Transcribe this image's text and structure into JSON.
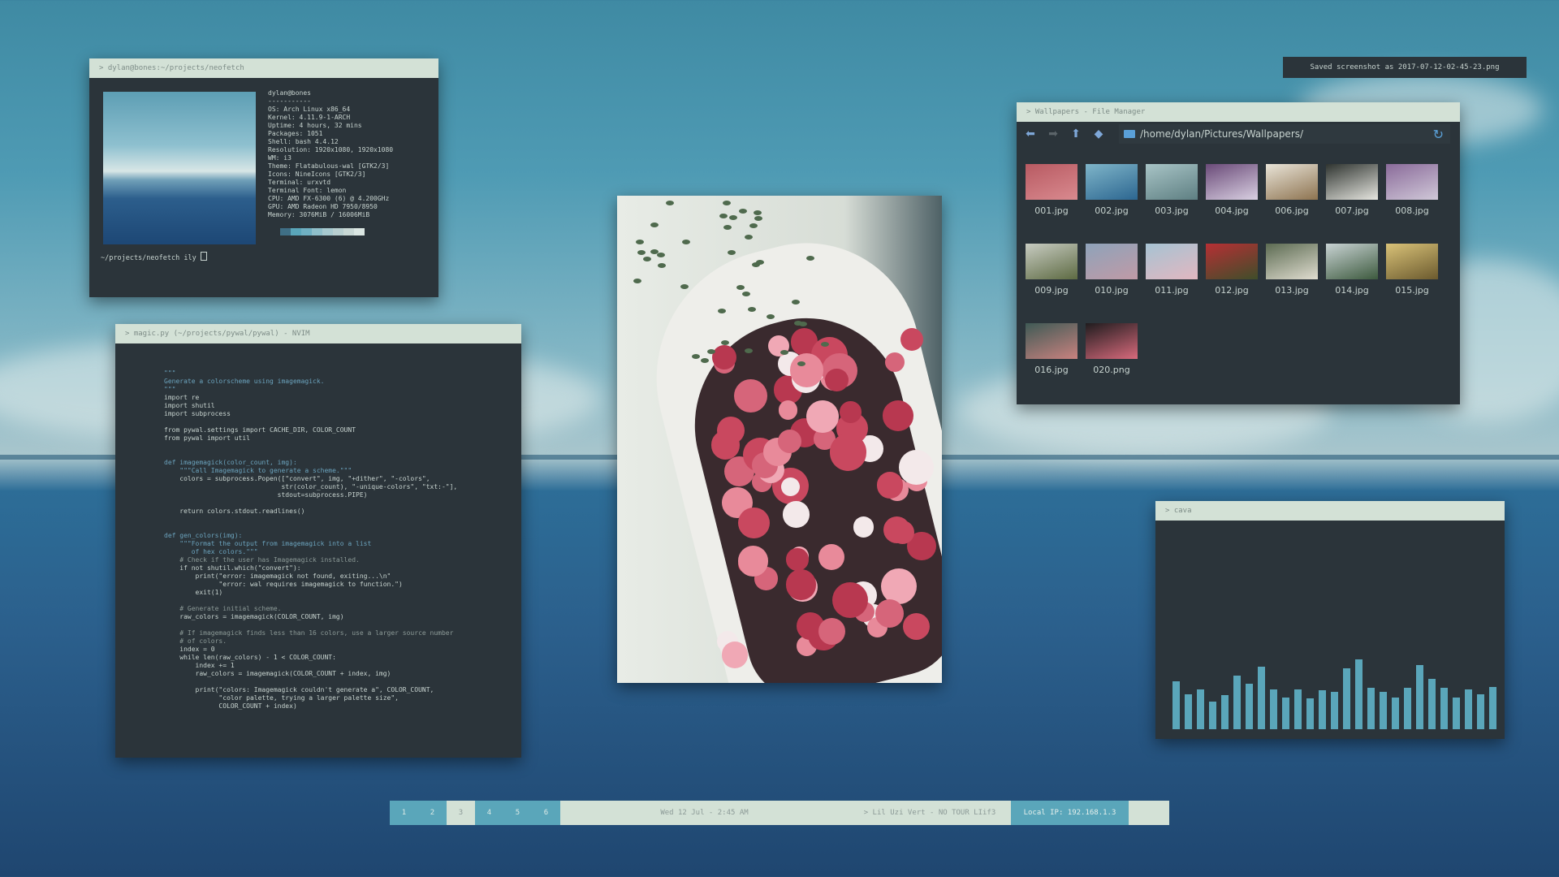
{
  "notification": "Saved screenshot as 2017-07-12-02-45-23.png",
  "neofetch": {
    "title": "> dylan@bones:~/projects/neofetch",
    "info": [
      "dylan@bones",
      "-----------",
      "OS: Arch Linux x86_64",
      "Kernel: 4.11.9-1-ARCH",
      "Uptime: 4 hours, 32 mins",
      "Packages: 1051",
      "Shell: bash 4.4.12",
      "Resolution: 1920x1080, 1920x1080",
      "WM: i3",
      "Theme: Flatabulous-wal [GTK2/3]",
      "Icons: NineIcons [GTK2/3]",
      "Terminal: urxvtd",
      "Terminal Font: lemon",
      "CPU: AMD FX-6300 (6) @ 4.200GHz",
      "GPU: AMD Radeon HD 7950/8950",
      "Memory: 3076MiB / 16006MiB"
    ],
    "palette": [
      "#3f6f86",
      "#5aa6ba",
      "#6fb0c2",
      "#8fbfca",
      "#a7c9cf",
      "#b8cfd0",
      "#c9d8d5",
      "#dbe6e2"
    ],
    "prompt": "~/projects/neofetch ily"
  },
  "nvim": {
    "title": "> magic.py (~/projects/pywal/pywal) - NVIM",
    "lines": [
      [
        "str",
        "\"\"\""
      ],
      [
        "str",
        "Generate a colorscheme using imagemagick."
      ],
      [
        "str",
        "\"\"\""
      ],
      [
        "txt",
        "import re"
      ],
      [
        "txt",
        "import shutil"
      ],
      [
        "txt",
        "import subprocess"
      ],
      [
        "txt",
        ""
      ],
      [
        "txt",
        "from pywal.settings import CACHE_DIR, COLOR_COUNT"
      ],
      [
        "txt",
        "from pywal import util"
      ],
      [
        "txt",
        ""
      ],
      [
        "txt",
        ""
      ],
      [
        "kw",
        "def imagemagick(color_count, img):"
      ],
      [
        "str",
        "    \"\"\"Call Imagemagick to generate a scheme.\"\"\""
      ],
      [
        "txt",
        "    colors = subprocess.Popen([\"convert\", img, \"+dither\", \"-colors\","
      ],
      [
        "txt",
        "                              str(color_count), \"-unique-colors\", \"txt:-\"],"
      ],
      [
        "txt",
        "                             stdout=subprocess.PIPE)"
      ],
      [
        "txt",
        ""
      ],
      [
        "txt",
        "    return colors.stdout.readlines()"
      ],
      [
        "txt",
        ""
      ],
      [
        "txt",
        ""
      ],
      [
        "kw",
        "def gen_colors(img):"
      ],
      [
        "str",
        "    \"\"\"Format the output from imagemagick into a list"
      ],
      [
        "str",
        "       of hex colors.\"\"\""
      ],
      [
        "cm",
        "    # Check if the user has Imagemagick installed."
      ],
      [
        "txt",
        "    if not shutil.which(\"convert\"):"
      ],
      [
        "txt",
        "        print(\"error: imagemagick not found, exiting...\\n\""
      ],
      [
        "txt",
        "              \"error: wal requires imagemagick to function.\")"
      ],
      [
        "txt",
        "        exit(1)"
      ],
      [
        "txt",
        ""
      ],
      [
        "cm",
        "    # Generate initial scheme."
      ],
      [
        "txt",
        "    raw_colors = imagemagick(COLOR_COUNT, img)"
      ],
      [
        "txt",
        ""
      ],
      [
        "cm",
        "    # If imagemagick finds less than 16 colors, use a larger source number"
      ],
      [
        "cm",
        "    # of colors."
      ],
      [
        "txt",
        "    index = 0"
      ],
      [
        "txt",
        "    while len(raw_colors) - 1 < COLOR_COUNT:"
      ],
      [
        "txt",
        "        index += 1"
      ],
      [
        "txt",
        "        raw_colors = imagemagick(COLOR_COUNT + index, img)"
      ],
      [
        "txt",
        ""
      ],
      [
        "txt",
        "        print(\"colors: Imagemagick couldn't generate a\", COLOR_COUNT,"
      ],
      [
        "txt",
        "              \"color palette, trying a larger palette size\","
      ],
      [
        "txt",
        "              COLOR_COUNT + index)"
      ]
    ]
  },
  "file_manager": {
    "title": "> Wallpapers - File Manager",
    "path": "/home/dylan/Pictures/Wallpapers/",
    "files": [
      {
        "name": "001.jpg",
        "colors": [
          "#b85a62",
          "#d98a8f"
        ]
      },
      {
        "name": "002.jpg",
        "colors": [
          "#7fb5c9",
          "#2c6690"
        ]
      },
      {
        "name": "003.jpg",
        "colors": [
          "#a8c4c6",
          "#5e7f82"
        ]
      },
      {
        "name": "004.jpg",
        "colors": [
          "#6a4a78",
          "#d9d0e2"
        ]
      },
      {
        "name": "006.jpg",
        "colors": [
          "#e9e4d8",
          "#8d7350"
        ]
      },
      {
        "name": "007.jpg",
        "colors": [
          "#2f3430",
          "#e6e6e0"
        ]
      },
      {
        "name": "008.jpg",
        "colors": [
          "#8a6b9a",
          "#d0c8d8"
        ]
      },
      {
        "name": "009.jpg",
        "colors": [
          "#c8ccc2",
          "#5d6a42"
        ]
      },
      {
        "name": "010.jpg",
        "colors": [
          "#8ea3ba",
          "#c09aa6"
        ]
      },
      {
        "name": "011.jpg",
        "colors": [
          "#a6c3d3",
          "#e2b7c0"
        ]
      },
      {
        "name": "012.jpg",
        "colors": [
          "#b72f34",
          "#3f4e2a"
        ]
      },
      {
        "name": "013.jpg",
        "colors": [
          "#5c6b52",
          "#e0ddd0"
        ]
      },
      {
        "name": "014.jpg",
        "colors": [
          "#c9d3d4",
          "#3d5a3e"
        ]
      },
      {
        "name": "015.jpg",
        "colors": [
          "#d9c278",
          "#6b5a2e"
        ]
      },
      {
        "name": "016.jpg",
        "colors": [
          "#3f5a55",
          "#c9827f"
        ]
      },
      {
        "name": "020.png",
        "colors": [
          "#1f1c1e",
          "#d86a7c"
        ]
      }
    ]
  },
  "cava": {
    "title": "> cava",
    "bar_levels": [
      0.45,
      0.33,
      0.38,
      0.26,
      0.32,
      0.51,
      0.43,
      0.59,
      0.38,
      0.3,
      0.38,
      0.29,
      0.37,
      0.35,
      0.58,
      0.66,
      0.39,
      0.35,
      0.3,
      0.39,
      0.61,
      0.48,
      0.39,
      0.3,
      0.38,
      0.33,
      0.4
    ],
    "bar_color": "#5aa6ba"
  },
  "statusbar": {
    "workspaces": [
      "1",
      "2",
      "3",
      "4",
      "5",
      "6"
    ],
    "active_workspace": "3",
    "datetime": "Wed 12 Jul -  2:45 AM",
    "song": "> Lil Uzi Vert - NO TOUR LIif3",
    "ip": "Local IP:  192.168.1.3"
  }
}
